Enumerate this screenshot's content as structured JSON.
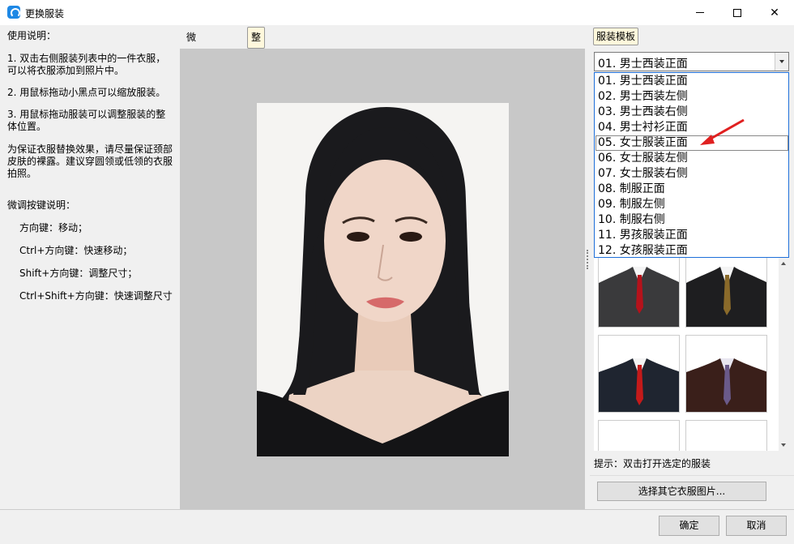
{
  "window": {
    "title": "更换服装",
    "icon": "app-logo-icon"
  },
  "instructions": {
    "heading": "使用说明：",
    "step1": "1. 双击右侧服装列表中的一件衣服，\n可以将衣服添加到照片中。",
    "step2": "2. 用鼠标拖动小黑点可以缩放服装。",
    "step3": "3. 用鼠标拖动服装可以调整服装的整\n体位置。",
    "tip": "为保证衣服替换效果，请尽量保证颈部\n皮肤的裸露。建议穿圆领或低领的衣服\n拍照。",
    "keys_heading": "微调按键说明：",
    "key1": "方向键：移动；",
    "key2": "Ctrl+方向键：快速移动；",
    "key3": "Shift+方向键：调整尺寸；",
    "key4": "Ctrl+Shift+方向键：快速调整尺寸"
  },
  "tabs": {
    "fine": "微调服装模式",
    "whole": "整体缩放模式"
  },
  "right": {
    "tab": "服装模板",
    "selected": "01. 男士西装正面",
    "options": [
      "01. 男士西装正面",
      "02. 男士西装左侧",
      "03. 男士西装右侧",
      "04. 男士衬衫正面",
      "05. 女士服装正面",
      "06. 女士服装左侧",
      "07. 女士服装右侧",
      "08. 制服正面",
      "09. 制服左侧",
      "10. 制服右侧",
      "11. 男孩服装正面",
      "12. 女孩服装正面"
    ],
    "hint": "提示：双击打开选定的服装",
    "other_button": "选择其它衣服图片..."
  },
  "buttons": {
    "ok": "确定",
    "cancel": "取消"
  },
  "colors": {
    "accent": "#1e6fd9",
    "tab_active": "#fff8dc",
    "arrow": "#e02020"
  }
}
